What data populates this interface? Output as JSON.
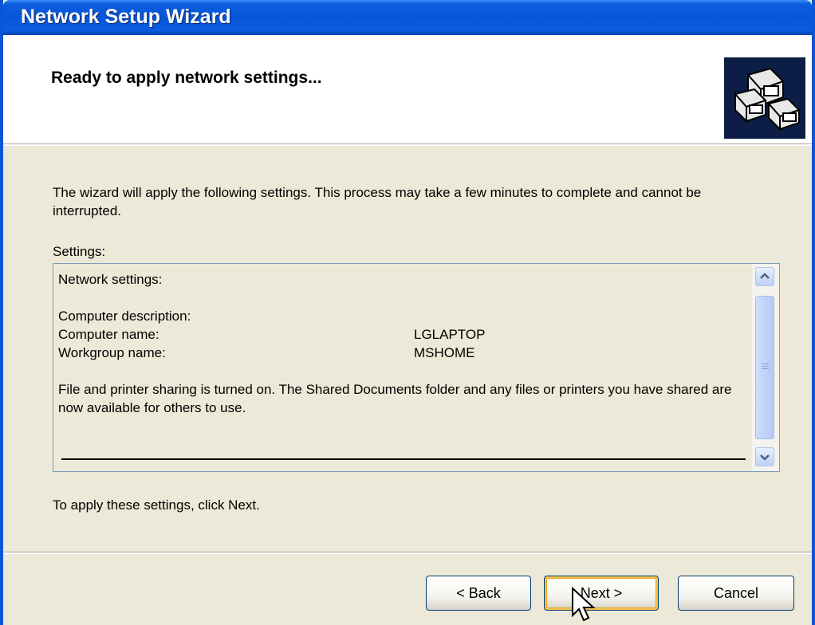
{
  "window": {
    "title": "Network Setup Wizard"
  },
  "header": {
    "title": "Ready to apply network settings...",
    "icon": "network-computers-icon"
  },
  "intro_text": "The wizard will apply the following settings. This process may take a few minutes to complete and cannot be interrupted.",
  "settings": {
    "label": "Settings:",
    "heading": "Network settings:",
    "rows": [
      {
        "key": "Computer description:",
        "value": ""
      },
      {
        "key": "Computer name:",
        "value": "LGLAPTOP"
      },
      {
        "key": "Workgroup name:",
        "value": "MSHOME"
      }
    ],
    "sharing_text": "File and printer sharing is turned on. The Shared Documents folder and any files or printers you have shared are now available for others to use."
  },
  "apply_text": "To apply these settings, click Next.",
  "buttons": {
    "back": "< Back",
    "next": "Next >",
    "cancel": "Cancel"
  },
  "colors": {
    "titlebar": "#0856d8",
    "dialog_bg": "#ece9d8",
    "default_button_highlight": "#f5c44e"
  }
}
